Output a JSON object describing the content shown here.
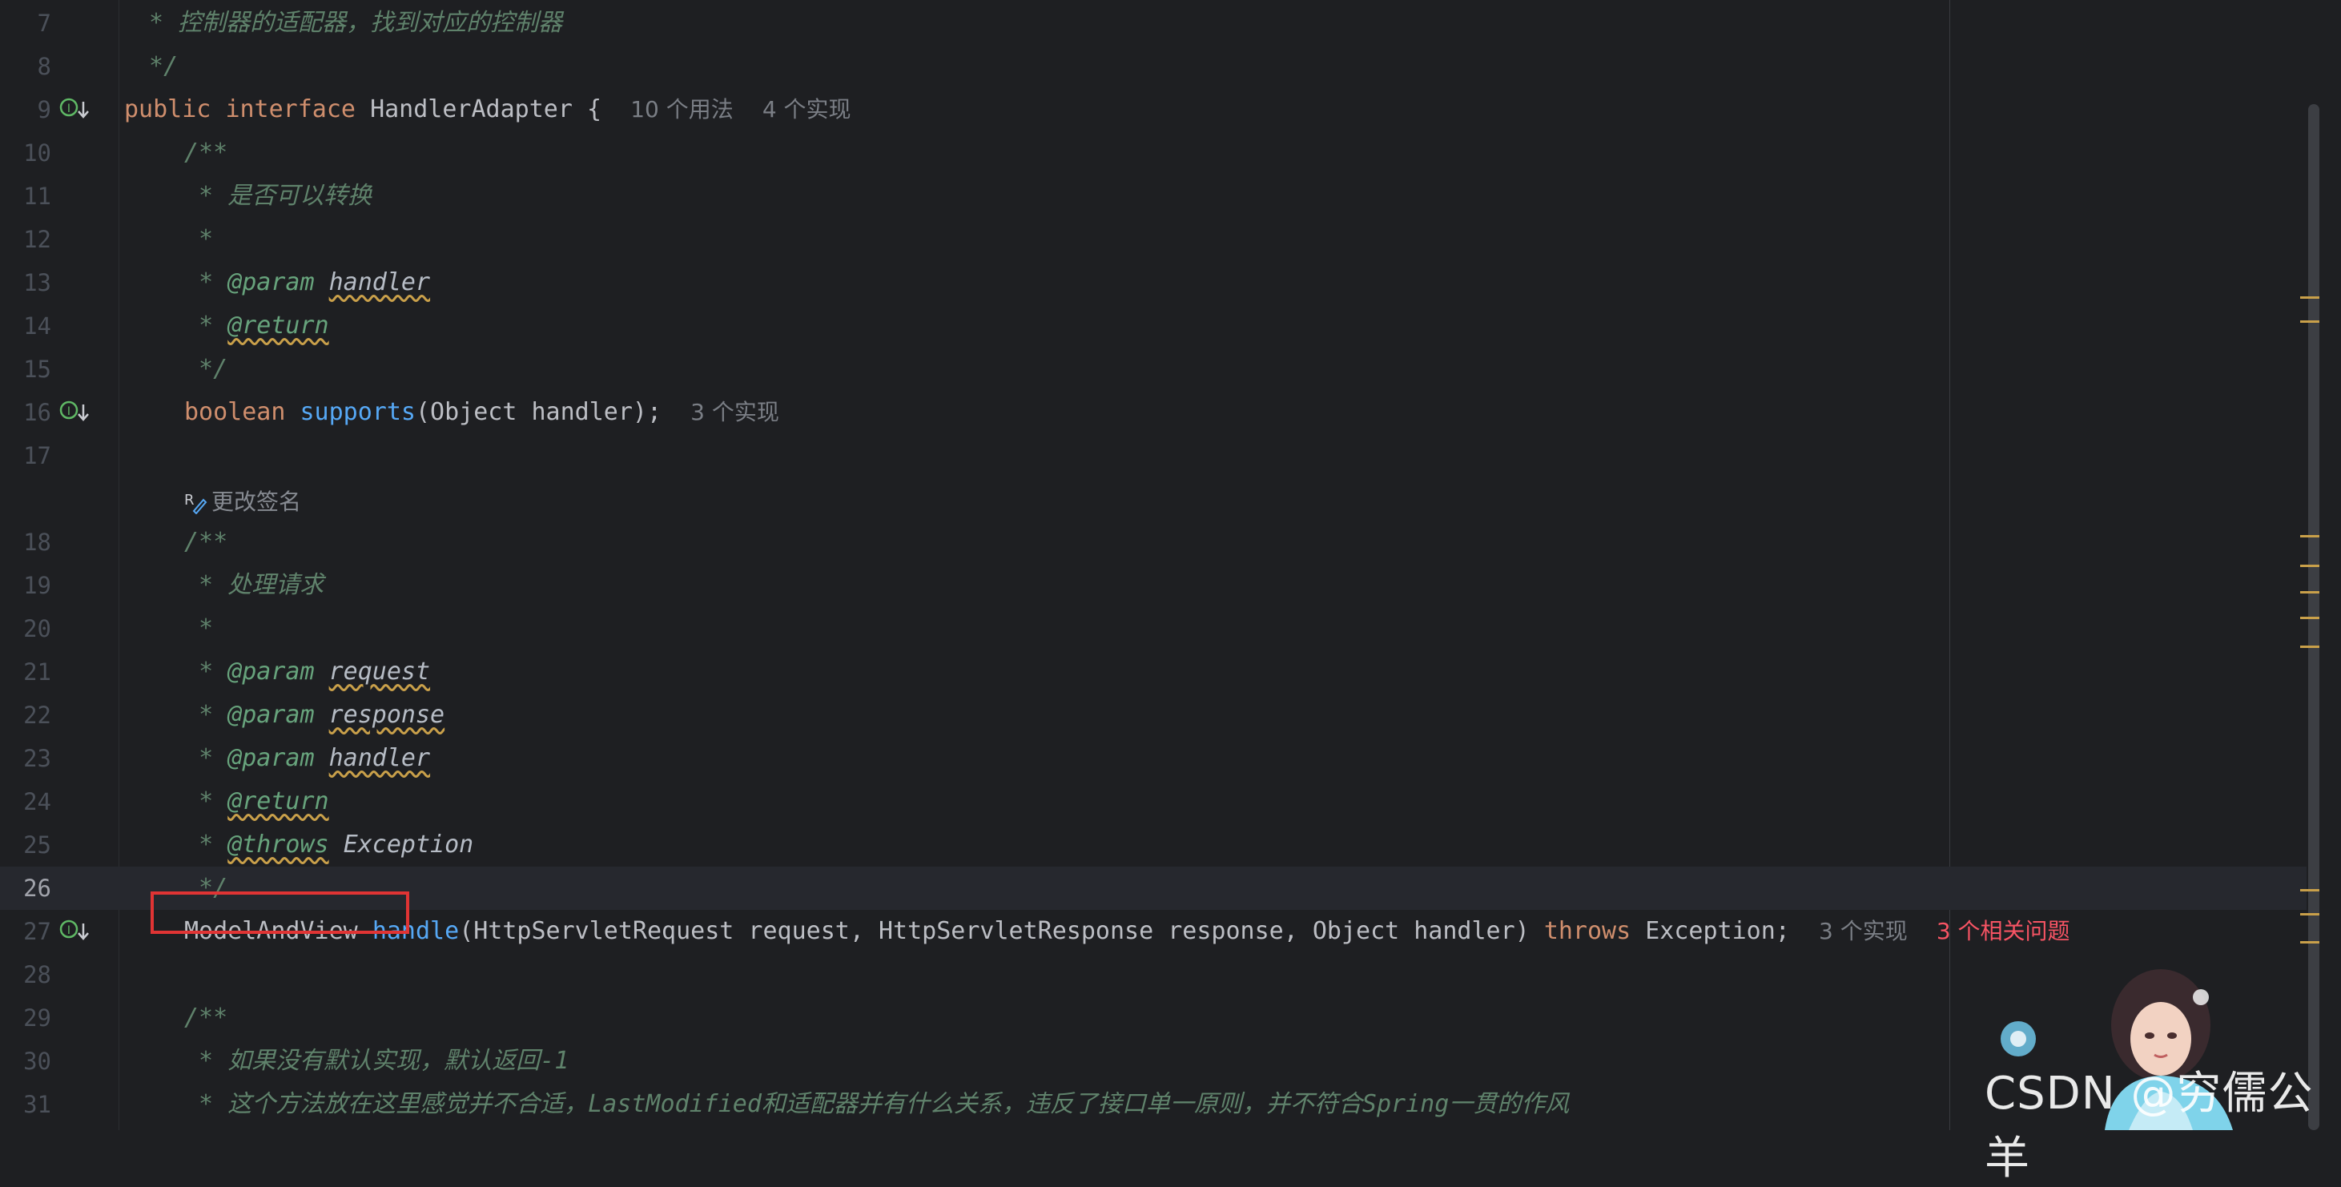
{
  "editor": {
    "lines": [
      {
        "num": "7",
        "text": " * 控制器的适配器，找到对应的控制器"
      },
      {
        "num": "8",
        "text": " */"
      },
      {
        "num": "9",
        "kw1": "public",
        "kw2": "interface",
        "name": "HandlerAdapter",
        "brace": "{",
        "hint1": "10 个用法",
        "hint2": "4 个实现"
      },
      {
        "num": "10",
        "text": "/**"
      },
      {
        "num": "11",
        "text": " * 是否可以转换"
      },
      {
        "num": "12",
        "text": " *"
      },
      {
        "num": "13",
        "tag": "@param",
        "param": "handler"
      },
      {
        "num": "14",
        "tag": "@return"
      },
      {
        "num": "15",
        "text": " */"
      },
      {
        "num": "16",
        "type": "boolean",
        "method": "supports",
        "args": "(Object handler);",
        "hint": "3 个实现"
      },
      {
        "num": "17"
      },
      {
        "num": "18",
        "text": "/**"
      },
      {
        "num": "19",
        "text": " * 处理请求"
      },
      {
        "num": "20",
        "text": " *"
      },
      {
        "num": "21",
        "tag": "@param",
        "param": "request"
      },
      {
        "num": "22",
        "tag": "@param",
        "param": "response"
      },
      {
        "num": "23",
        "tag": "@param",
        "param": "handler"
      },
      {
        "num": "24",
        "tag": "@return"
      },
      {
        "num": "25",
        "tag": "@throws",
        "param": "Exception"
      },
      {
        "num": "26",
        "text": " */"
      },
      {
        "num": "27",
        "type": "ModelAndView",
        "method": "handle",
        "args": "(HttpServletRequest request, HttpServletResponse response, Object handler)",
        "kw": "throws",
        "rest": "Exception;",
        "hint": "3 个实现",
        "hint_err": "3 个相关问题"
      },
      {
        "num": "28"
      },
      {
        "num": "29",
        "text": "/**"
      },
      {
        "num": "30",
        "text": " * 如果没有默认实现，默认返回-1"
      },
      {
        "num": "31",
        "text": " * 这个方法放在这里感觉并不合适，LastModified和适配器并有什么关系，违反了接口单一原则，并不符合Spring一贯的作风"
      }
    ],
    "lens_label": "更改签名",
    "star": "*"
  },
  "watermark": "CSDN @穷儒公羊",
  "colors": {
    "accent": "#56a8f5",
    "keyword": "#cf8e6d",
    "comment": "#5f826b",
    "error": "#f75464",
    "highlight": "#e03434"
  }
}
